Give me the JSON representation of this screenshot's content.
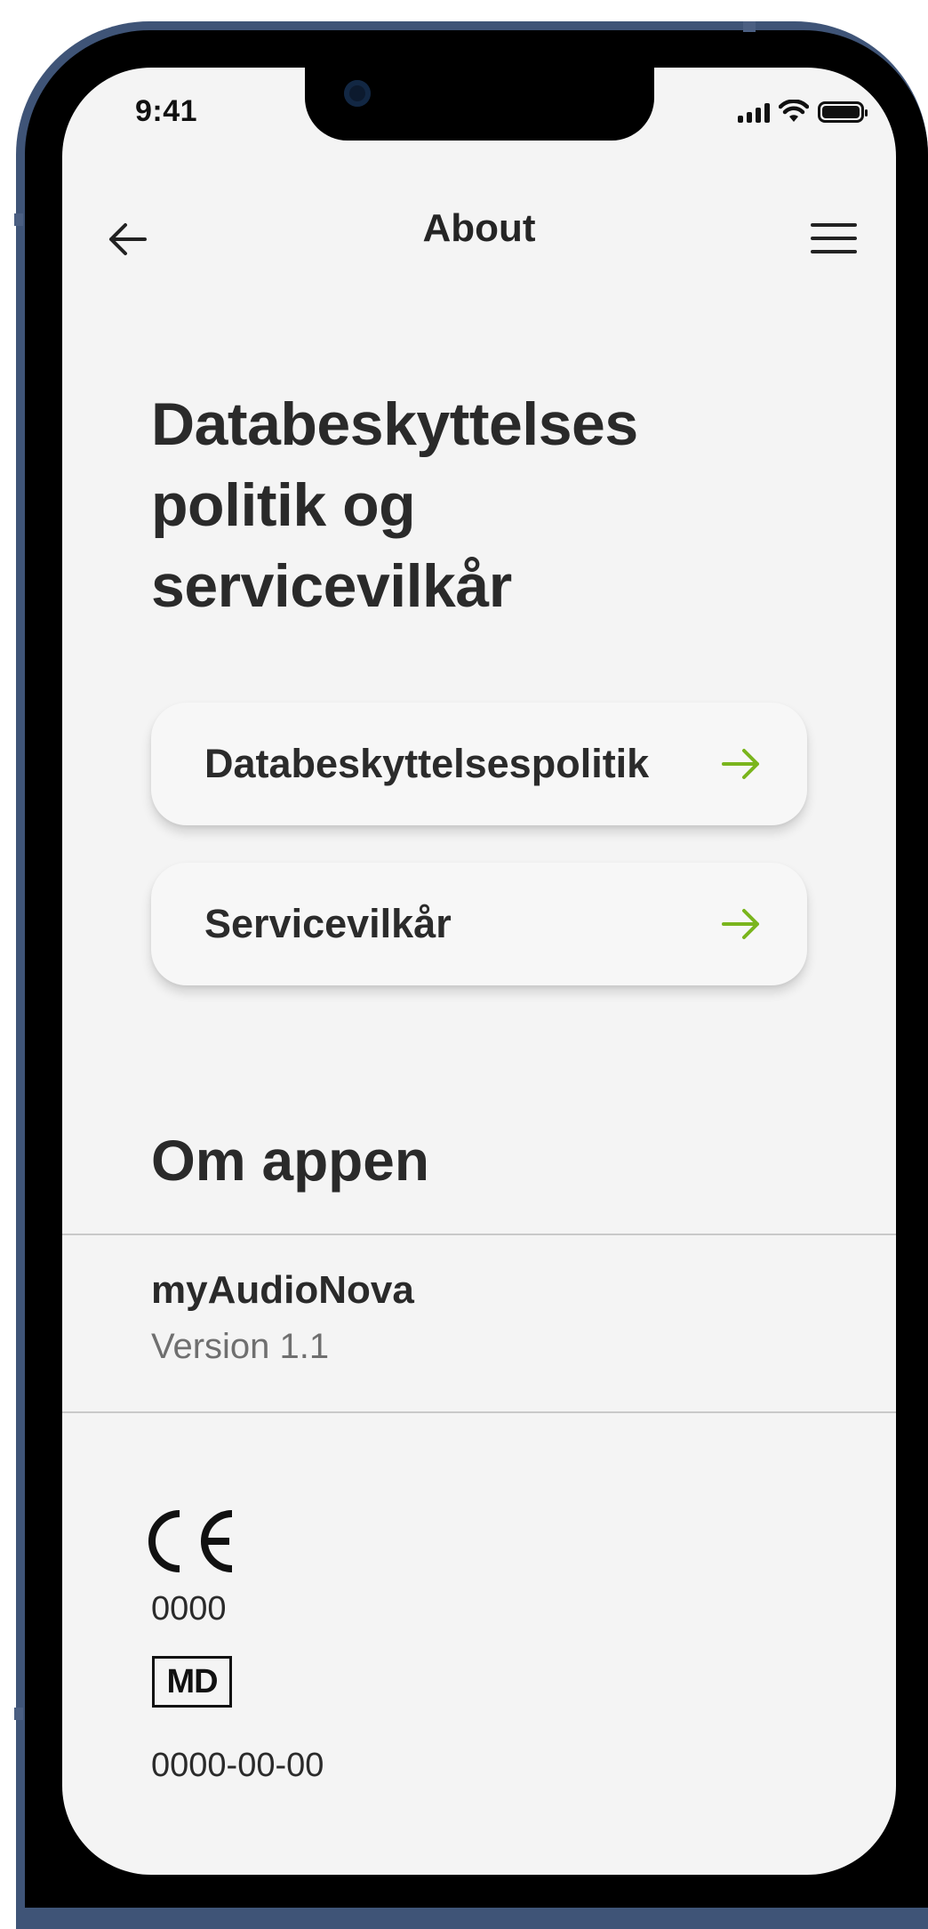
{
  "status_bar": {
    "time": "9:41",
    "signal_icon": "cellular-signal-icon",
    "wifi_icon": "wifi-icon",
    "battery_icon": "battery-icon"
  },
  "nav": {
    "title": "About",
    "back_icon": "arrow-left-icon",
    "menu_icon": "hamburger-menu-icon"
  },
  "main": {
    "heading_lines": [
      "Databeskyttelses",
      "politik og",
      "servicevilkår"
    ],
    "links": [
      {
        "label": "Databeskyttelsespolitik",
        "icon": "arrow-right-icon"
      },
      {
        "label": "Servicevilkår",
        "icon": "arrow-right-icon"
      }
    ],
    "about_section": {
      "title": "Om appen",
      "app_name": "myAudioNova",
      "version": "Version 1.1"
    },
    "regulatory": {
      "ce_mark": "CE",
      "notified_body": "0000",
      "md_label": "MD",
      "date": "0000-00-00"
    }
  },
  "colors": {
    "frame": "#3f5477",
    "background": "#f4f4f4",
    "text": "#2a2a2a",
    "accent_arrow": "#7ab51d",
    "secondary_text": "#6f6f6f"
  }
}
